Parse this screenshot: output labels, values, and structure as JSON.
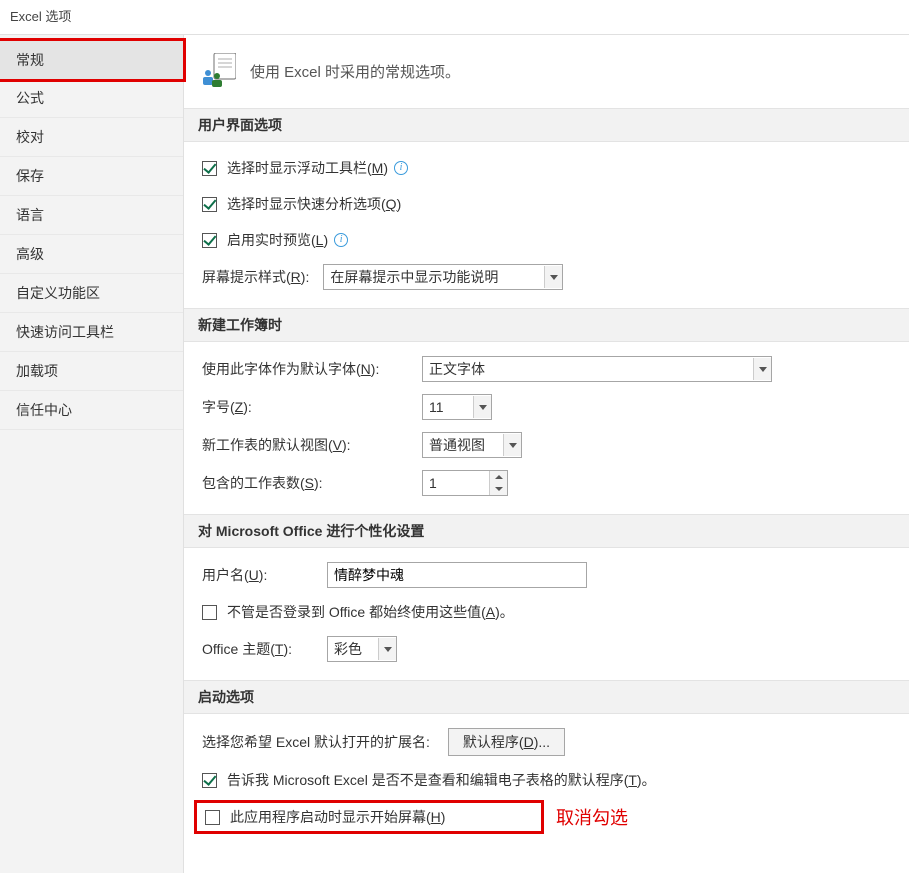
{
  "window": {
    "title": "Excel 选项"
  },
  "sidebar": {
    "items": [
      {
        "label": "常规",
        "selected": true
      },
      {
        "label": "公式"
      },
      {
        "label": "校对"
      },
      {
        "label": "保存"
      },
      {
        "label": "语言"
      },
      {
        "label": "高级"
      },
      {
        "label": "自定义功能区"
      },
      {
        "label": "快速访问工具栏"
      },
      {
        "label": "加载项"
      },
      {
        "label": "信任中心"
      }
    ]
  },
  "heading": "使用 Excel 时采用的常规选项。",
  "sections": {
    "ui": {
      "title": "用户界面选项",
      "mini_toolbar": {
        "label_pre": "选择时显示浮动工具栏(",
        "hotkey": "M",
        "label_post": ")",
        "checked": true,
        "info": true
      },
      "quick_analysis": {
        "label_pre": "选择时显示快速分析选项(",
        "hotkey": "Q",
        "label_post": ")",
        "checked": true
      },
      "live_preview": {
        "label_pre": "启用实时预览(",
        "hotkey": "L",
        "label_post": ")",
        "checked": true,
        "info": true
      },
      "screentip": {
        "label_pre": "屏幕提示样式(",
        "hotkey": "R",
        "label_post": "):",
        "value": "在屏幕提示中显示功能说明"
      }
    },
    "new_wb": {
      "title": "新建工作簿时",
      "font": {
        "label_pre": "使用此字体作为默认字体(",
        "hotkey": "N",
        "label_post": "):",
        "value": "正文字体"
      },
      "size": {
        "label_pre": "字号(",
        "hotkey": "Z",
        "label_post": "):",
        "value": "11"
      },
      "view": {
        "label_pre": "新工作表的默认视图(",
        "hotkey": "V",
        "label_post": "):",
        "value": "普通视图"
      },
      "sheets": {
        "label_pre": "包含的工作表数(",
        "hotkey": "S",
        "label_post": "):",
        "value": "1"
      }
    },
    "personalize": {
      "title": "对 Microsoft Office 进行个性化设置",
      "username": {
        "label_pre": "用户名(",
        "hotkey": "U",
        "label_post": "):",
        "value": "情醉梦中魂"
      },
      "always_use": {
        "label_pre": "不管是否登录到 Office 都始终使用这些值(",
        "hotkey": "A",
        "label_post": ")。",
        "checked": false
      },
      "theme": {
        "label_pre": "Office 主题(",
        "hotkey": "T",
        "label_post": "):",
        "value": "彩色"
      }
    },
    "startup": {
      "title": "启动选项",
      "extensions": {
        "label": "选择您希望 Excel 默认打开的扩展名:",
        "button_pre": "默认程序(",
        "button_hotkey": "D",
        "button_post": ")..."
      },
      "tell_me": {
        "label_pre": "告诉我 Microsoft Excel 是否不是查看和编辑电子表格的默认程序(",
        "hotkey": "T",
        "label_post": ")。",
        "checked": true
      },
      "start_screen": {
        "label_pre": "此应用程序启动时显示开始屏幕(",
        "hotkey": "H",
        "label_post": ")",
        "checked": false
      }
    }
  },
  "annotation": "取消勾选"
}
